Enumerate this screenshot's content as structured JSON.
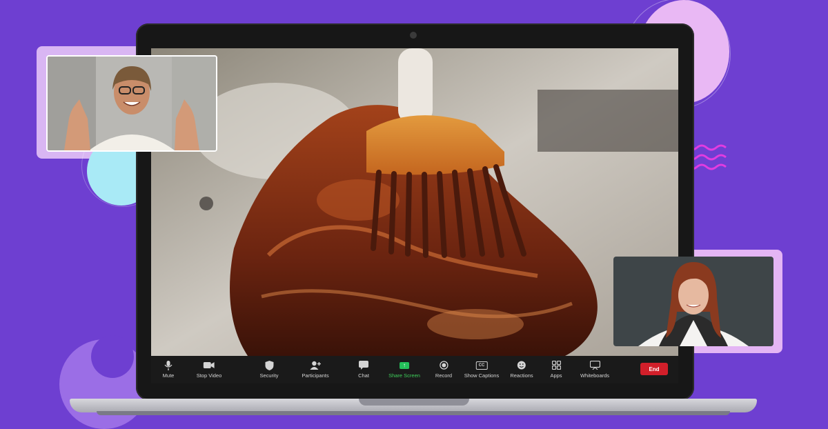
{
  "toolbar": {
    "items": [
      {
        "label": "Mute",
        "icon": "microphone-icon"
      },
      {
        "label": "Stop Video",
        "icon": "video-camera-icon"
      },
      {
        "label": "Security",
        "icon": "shield-icon"
      },
      {
        "label": "Participants",
        "icon": "participants-icon"
      },
      {
        "label": "Chat",
        "icon": "chat-bubble-icon"
      },
      {
        "label": "Share Screen",
        "icon": "share-screen-icon"
      },
      {
        "label": "Record",
        "icon": "record-icon"
      },
      {
        "label": "Show Captions",
        "icon": "captions-icon"
      },
      {
        "label": "Reactions",
        "icon": "smiley-icon"
      },
      {
        "label": "Apps",
        "icon": "apps-icon"
      },
      {
        "label": "Whiteboards",
        "icon": "whiteboard-icon"
      }
    ],
    "captions_badge": "CC",
    "end_label": "End"
  },
  "colors": {
    "background": "#6e3fd1",
    "share_active": "#24c05a",
    "end_button": "#d21f2a",
    "toolbar": "#1a1a1a"
  }
}
